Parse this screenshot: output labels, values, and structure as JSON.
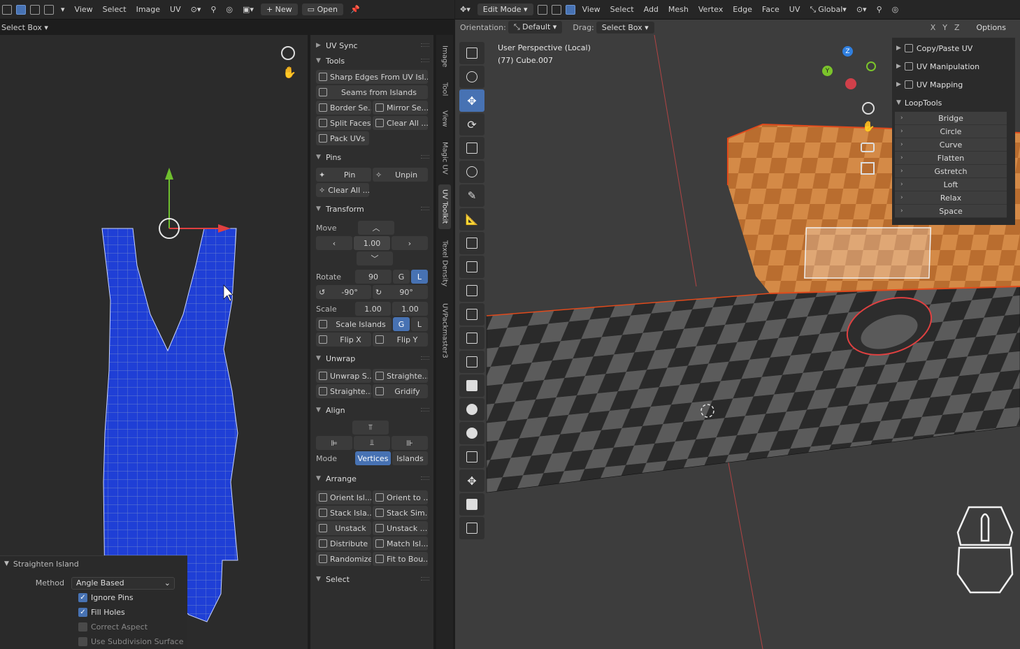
{
  "uv_editor": {
    "header": {
      "menus": [
        "View",
        "Select",
        "Image",
        "UV"
      ],
      "new_label": "New",
      "open_label": "Open"
    },
    "select_mode": "Select Box"
  },
  "npanel": {
    "uv_sync": "UV Sync",
    "tools": {
      "title": "Tools",
      "sharp_edges": "Sharp Edges From UV Isl...",
      "seams_from_islands": "Seams from Islands",
      "border_seam": "Border Se...",
      "mirror_seam": "Mirror Se...",
      "split_faces": "Split Faces",
      "clear_all": "Clear All ...",
      "pack_uvs": "Pack UVs"
    },
    "pins": {
      "title": "Pins",
      "pin": "Pin",
      "unpin": "Unpin",
      "clear_all": "Clear All ..."
    },
    "transform": {
      "title": "Transform",
      "move_label": "Move",
      "move_value": "1.00",
      "rotate_label": "Rotate",
      "rotate_value": "90",
      "g": "G",
      "l": "L",
      "rot_neg": "-90°",
      "rot_pos": "90°",
      "scale_label": "Scale",
      "scale_x": "1.00",
      "scale_y": "1.00",
      "scale_islands": "Scale Islands",
      "flip_x": "Flip X",
      "flip_y": "Flip Y"
    },
    "unwrap": {
      "title": "Unwrap",
      "unwrap_s": "Unwrap S...",
      "straighten1": "Straighte...",
      "straighten2": "Straighte...",
      "gridify": "Gridify"
    },
    "align": {
      "title": "Align",
      "mode_label": "Mode",
      "vertices": "Vertices",
      "islands": "Islands"
    },
    "arrange": {
      "title": "Arrange",
      "orient_isl": "Orient Isl...",
      "orient_to": "Orient to ...",
      "stack_isl": "Stack Isla...",
      "stack_sim": "Stack Sim...",
      "unstack": "Unstack",
      "unstack2": "Unstack ...",
      "distribute": "Distribute",
      "match_isl": "Match Isl...",
      "randomize": "Randomize",
      "fit_to_bou": "Fit to Bou..."
    },
    "select": {
      "title": "Select"
    }
  },
  "vtabs": [
    "Image",
    "Tool",
    "View",
    "Magic UV",
    "UV Toolkit",
    "Texel Density",
    "UVPackmaster3"
  ],
  "viewport": {
    "mode": "Edit Mode",
    "menus": [
      "View",
      "Select",
      "Add",
      "Mesh",
      "Vertex",
      "Edge",
      "Face",
      "UV"
    ],
    "transform_orientation": "Global",
    "orientation_label": "Orientation:",
    "orientation_value": "Default",
    "drag_label": "Drag:",
    "drag_value": "Select Box",
    "axes": [
      "X",
      "Y",
      "Z"
    ],
    "options": "Options",
    "perspective": "User Perspective (Local)",
    "object": "(77) Cube.007"
  },
  "right_panel": {
    "copy_paste_uv": "Copy/Paste UV",
    "uv_manipulation": "UV Manipulation",
    "uv_mapping": "UV Mapping",
    "looptools": "LoopTools",
    "looptools_items": [
      "Bridge",
      "Circle",
      "Curve",
      "Flatten",
      "Gstretch",
      "Loft",
      "Relax",
      "Space"
    ]
  },
  "redo_panel": {
    "title": "Straighten Island",
    "method_label": "Method",
    "method_value": "Angle Based",
    "ignore_pins": "Ignore Pins",
    "fill_holes": "Fill Holes",
    "correct_aspect": "Correct Aspect",
    "use_subdivision": "Use Subdivision Surface"
  },
  "colors": {
    "accent": "#4772b3",
    "uv_island": "#1f3fd6",
    "selection": "#e04a1c"
  }
}
